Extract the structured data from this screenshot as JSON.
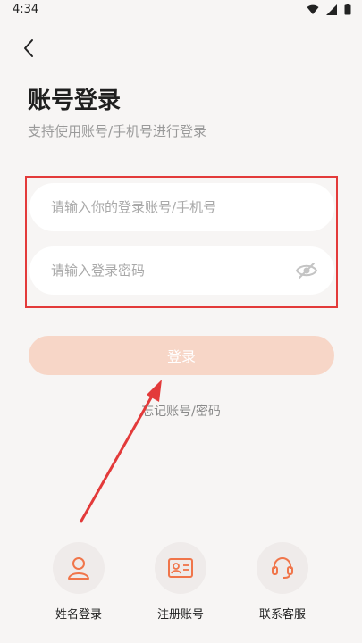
{
  "status_bar": {
    "time": "4:34"
  },
  "header": {
    "title": "账号登录",
    "subtitle": "支持使用账号/手机号进行登录"
  },
  "form": {
    "account_placeholder": "请输入你的登录账号/手机号",
    "password_placeholder": "请输入登录密码",
    "login_label": "登录",
    "forgot_label": "忘记账号/密码"
  },
  "bottom_options": [
    {
      "label": "姓名登录",
      "icon": "person-icon"
    },
    {
      "label": "注册账号",
      "icon": "id-card-icon"
    },
    {
      "label": "联系客服",
      "icon": "headset-icon"
    }
  ],
  "colors": {
    "accent": "#f0754a",
    "login_button_disabled": "#f7d6c7",
    "highlight_box": "#e33a3a",
    "annotation_arrow": "#e33a3a"
  }
}
